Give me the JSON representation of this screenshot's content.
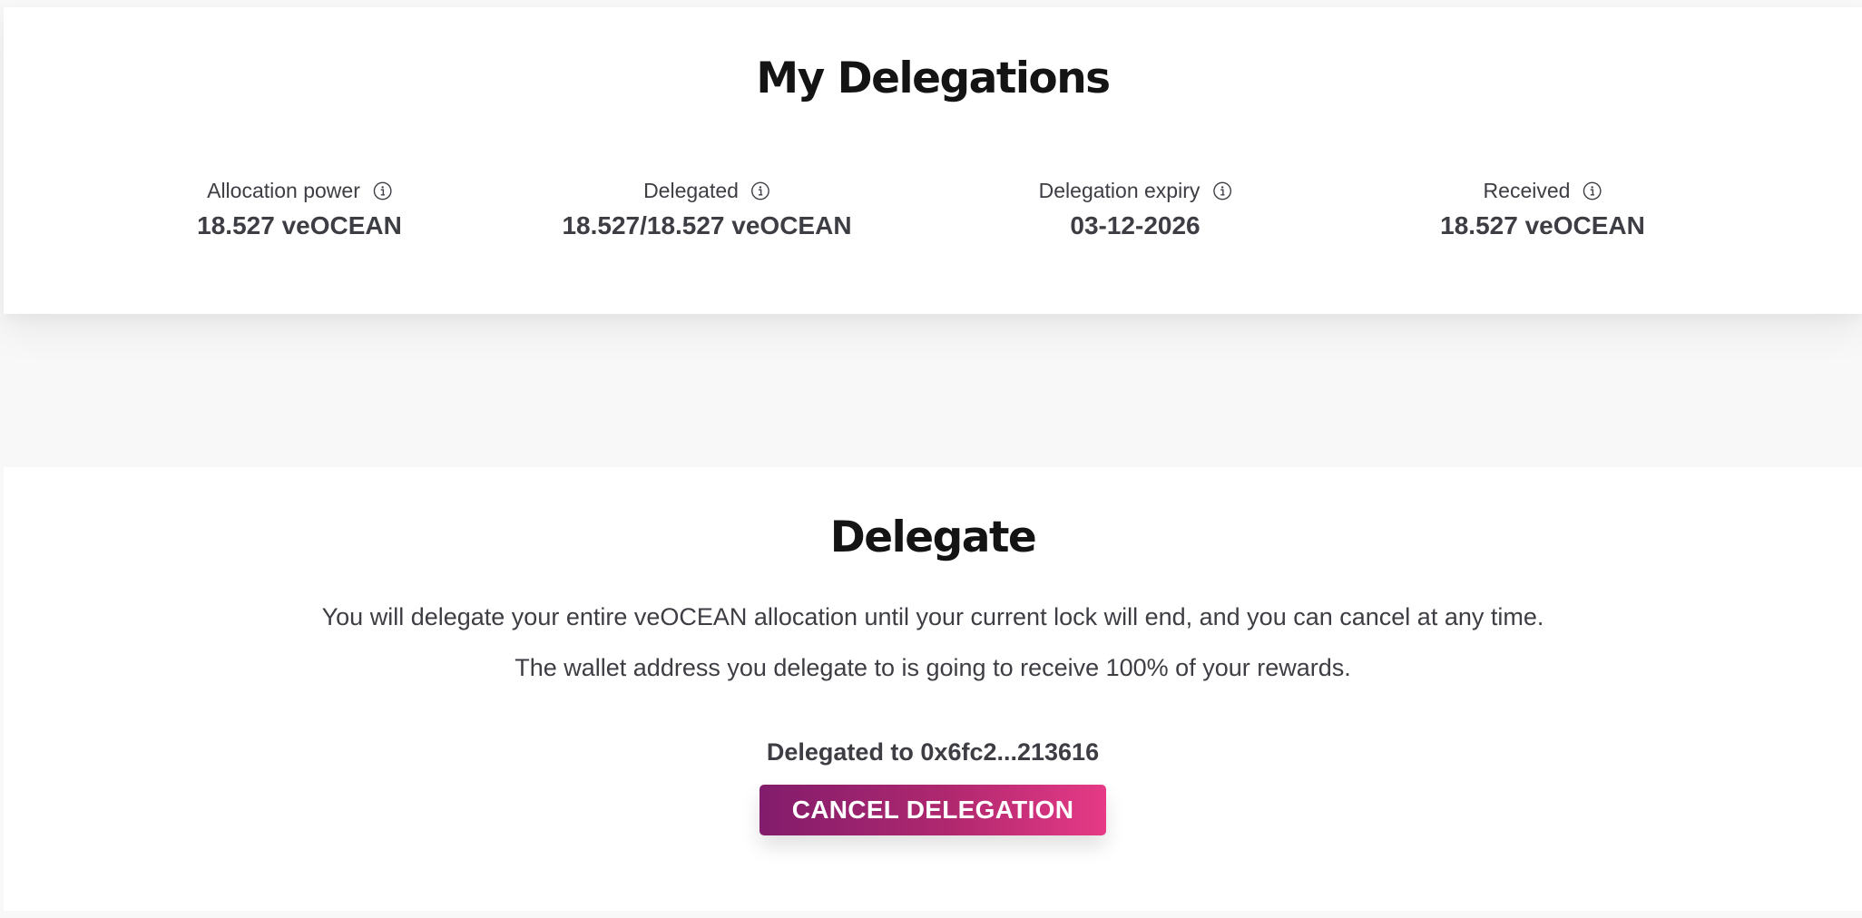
{
  "my_delegations": {
    "title": "My Delegations",
    "stats": [
      {
        "label": "Allocation power",
        "value": "18.527 veOCEAN",
        "icon": "info-icon"
      },
      {
        "label": "Delegated",
        "value": "18.527/18.527 veOCEAN",
        "icon": "info-icon"
      },
      {
        "label": "Delegation expiry",
        "value": "03-12-2026",
        "icon": "info-icon"
      },
      {
        "label": "Received",
        "value": "18.527 veOCEAN",
        "icon": "info-icon"
      }
    ]
  },
  "delegate": {
    "title": "Delegate",
    "description_1": "You will delegate your entire veOCEAN allocation until your current lock will end, and you can cancel at any time.",
    "description_2": "The wallet address you delegate to is going to receive 100% of your rewards.",
    "delegated_to": "Delegated to 0x6fc2...213616",
    "cancel_button_label": "CANCEL DELEGATION"
  },
  "colors": {
    "page_background": "#f8f8f8",
    "card_background": "#ffffff",
    "text": "#3d3d44",
    "title": "#141414",
    "button_gradient_start": "#821c6c",
    "button_gradient_end": "#e63a86"
  }
}
